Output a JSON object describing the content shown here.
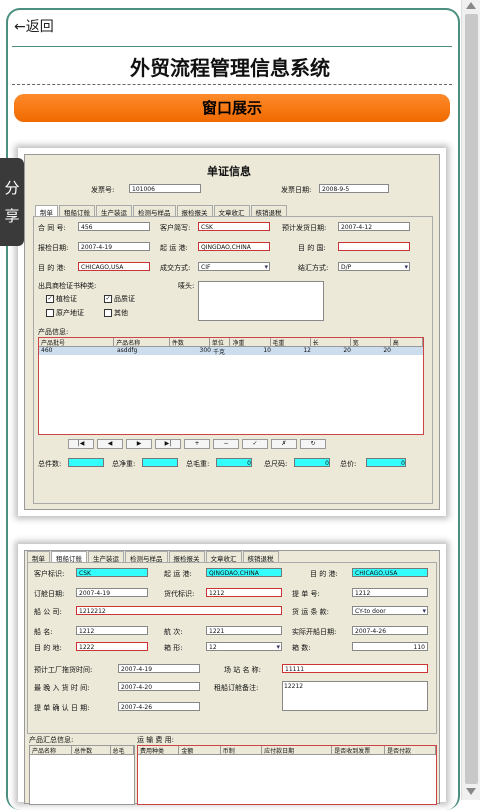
{
  "nav": {
    "back_label": "←返回"
  },
  "page": {
    "title": "外贸流程管理信息系统",
    "banner": "窗口展示",
    "share_label": [
      "分",
      "享"
    ]
  },
  "shot1": {
    "title": "单证信息",
    "invoice_no_label": "发票号:",
    "invoice_no": "101006",
    "invoice_date_label": "发票日期:",
    "invoice_date": "2008-9-5",
    "tabs": [
      "制单",
      "租船订舱",
      "生产装运",
      "检测与样品",
      "报检报关",
      "文章收汇",
      "核销退税"
    ],
    "contract_label": "合 同 号:",
    "contract": "456",
    "customer_label": "客户简写:",
    "customer": "CSK",
    "ship_date_label": "预计发货日期:",
    "ship_date": "2007-4-12",
    "inspect_date_label": "报检日期:",
    "inspect_date": "2007-4-19",
    "port_from_label": "起 运 港:",
    "port_from": "QINGDAO,CHINA",
    "dest_country_label": "目 的 国:",
    "dest_country": "",
    "port_to_label": "目 的 港:",
    "port_to": "CHICAGO,USA",
    "deal_label": "成交方式:",
    "deal": "CIF",
    "pay_label": "结汇方式:",
    "pay": "D/P",
    "cert_label": "出具商检证书种类:",
    "certs": [
      {
        "label": "植检证",
        "checked": "✓"
      },
      {
        "label": "品质证",
        "checked": "✓"
      },
      {
        "label": "原产地证",
        "checked": ""
      },
      {
        "label": "其他",
        "checked": ""
      }
    ],
    "mark_label": "唛头:",
    "product_info_label": "产品信息:",
    "grid_headers": [
      "产品批号",
      "产品名称",
      "件数",
      "单位",
      "净重",
      "毛重",
      "长",
      "宽",
      "高"
    ],
    "grid_row": [
      "460",
      "asddfg",
      "300",
      "千克",
      "10",
      "12",
      "20",
      "20",
      ""
    ],
    "nav_buttons": [
      "|◀",
      "◀",
      "▶",
      "▶|",
      "+",
      "−",
      "✓",
      "✗",
      "↻"
    ],
    "totals": [
      {
        "label": "总件数:",
        "value": ""
      },
      {
        "label": "总净重:",
        "value": ""
      },
      {
        "label": "总毛重:",
        "value": "0"
      },
      {
        "label": "总尺码:",
        "value": "0"
      },
      {
        "label": "总价:",
        "value": "0"
      }
    ]
  },
  "shot2": {
    "tabs": [
      "制单",
      "租船订舱",
      "生产装运",
      "检测与样品",
      "报检报关",
      "文章收汇",
      "核销退税"
    ],
    "customer_label": "客户标识:",
    "customer": "CSK",
    "port_from_label": "起 运 港:",
    "port_from": "QINGDAO,CHINA",
    "port_to_label": "目 的 港:",
    "port_to": "CHICAGO,USA",
    "book_date_label": "订舱日期:",
    "book_date": "2007-4-19",
    "agent_label": "货代标识:",
    "agent": "1212",
    "bill_label": "提 单 号:",
    "bill": "1212",
    "ship_co_label": "船 公 司:",
    "ship_co": "1212212",
    "freight_label": "货 运 条 款:",
    "freight": "CY-to door",
    "ship_name_label": "船 名:",
    "ship_name": "1212",
    "voyage_label": "航 次:",
    "voyage": "1221",
    "sail_date_label": "实际开船日期:",
    "sail_date": "2007-4-26",
    "dest_label": "目 的 地:",
    "dest": "1222",
    "box_type_label": "箱 形:",
    "box_type": "12",
    "box_count_label": "箱 数:",
    "box_count": "110",
    "factory_date_label": "预计工厂拖货时间:",
    "factory_date": "2007-4-19",
    "yard_label": "场 站 名 称:",
    "yard": "11111",
    "latest_in_label": "最 晚 入 货 时 间:",
    "latest_in": "2007-4-20",
    "remark_label": "租船订舱备注:",
    "remark": "12212",
    "bill_confirm_label": "提 单 确 认 日 期:",
    "bill_confirm": "2007-4-26",
    "summary_label": "产品汇总信息:",
    "summary_headers": [
      "产品名称",
      "总件数",
      "总毛"
    ],
    "fee_label": "运 输 费 用:",
    "fee_headers": [
      "费用种类",
      "金额",
      "币制",
      "应付款日期",
      "是否收到发票",
      "是否付款"
    ]
  }
}
